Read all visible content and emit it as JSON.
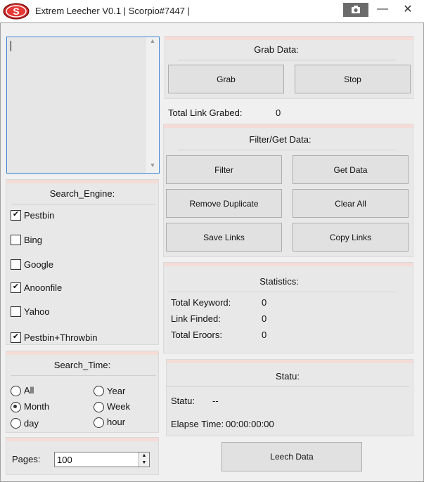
{
  "window": {
    "title": "Extrem Leecher V0.1 | Scorpio#7447 |",
    "logo_letter": "S",
    "minimize_glyph": "—",
    "close_glyph": "✕"
  },
  "search_engine": {
    "header": "Search_Engine:",
    "items": [
      {
        "label": "Pestbin",
        "checked": true
      },
      {
        "label": "Bing",
        "checked": false
      },
      {
        "label": "Google",
        "checked": false
      },
      {
        "label": "Anoonfile",
        "checked": true
      },
      {
        "label": "Yahoo",
        "checked": false
      },
      {
        "label": "Pestbin+Throwbin",
        "checked": true
      }
    ]
  },
  "search_time": {
    "header": "Search_Time:",
    "options": [
      {
        "label": "All",
        "selected": false
      },
      {
        "label": "Year",
        "selected": false
      },
      {
        "label": "Month",
        "selected": true
      },
      {
        "label": "Week",
        "selected": false
      },
      {
        "label": "day",
        "selected": false
      },
      {
        "label": "hour",
        "selected": false
      }
    ]
  },
  "pages": {
    "label": "Pages:",
    "value": "100"
  },
  "grab": {
    "header": "Grab Data:",
    "grab_label": "Grab",
    "stop_label": "Stop",
    "total_label": "Total Link Grabed:",
    "total_value": "0"
  },
  "filter": {
    "header": "Filter/Get Data:",
    "buttons": {
      "filter": "Filter",
      "get_data": "Get Data",
      "remove_duplicate": "Remove Duplicate",
      "clear_all": "Clear All",
      "save_links": "Save Links",
      "copy_links": "Copy Links"
    }
  },
  "statistics": {
    "header": "Statistics:",
    "rows": [
      {
        "label": "Total Keyword:",
        "value": "0"
      },
      {
        "label": "Link Finded:",
        "value": "0"
      },
      {
        "label": "Total Eroors:",
        "value": "0"
      }
    ]
  },
  "status": {
    "header": "Statu:",
    "statu_label": "Statu:",
    "statu_value": "--",
    "elapse_label": "Elapse Time:",
    "elapse_value": "00:00:00:00"
  },
  "leech_label": "Leech Data"
}
